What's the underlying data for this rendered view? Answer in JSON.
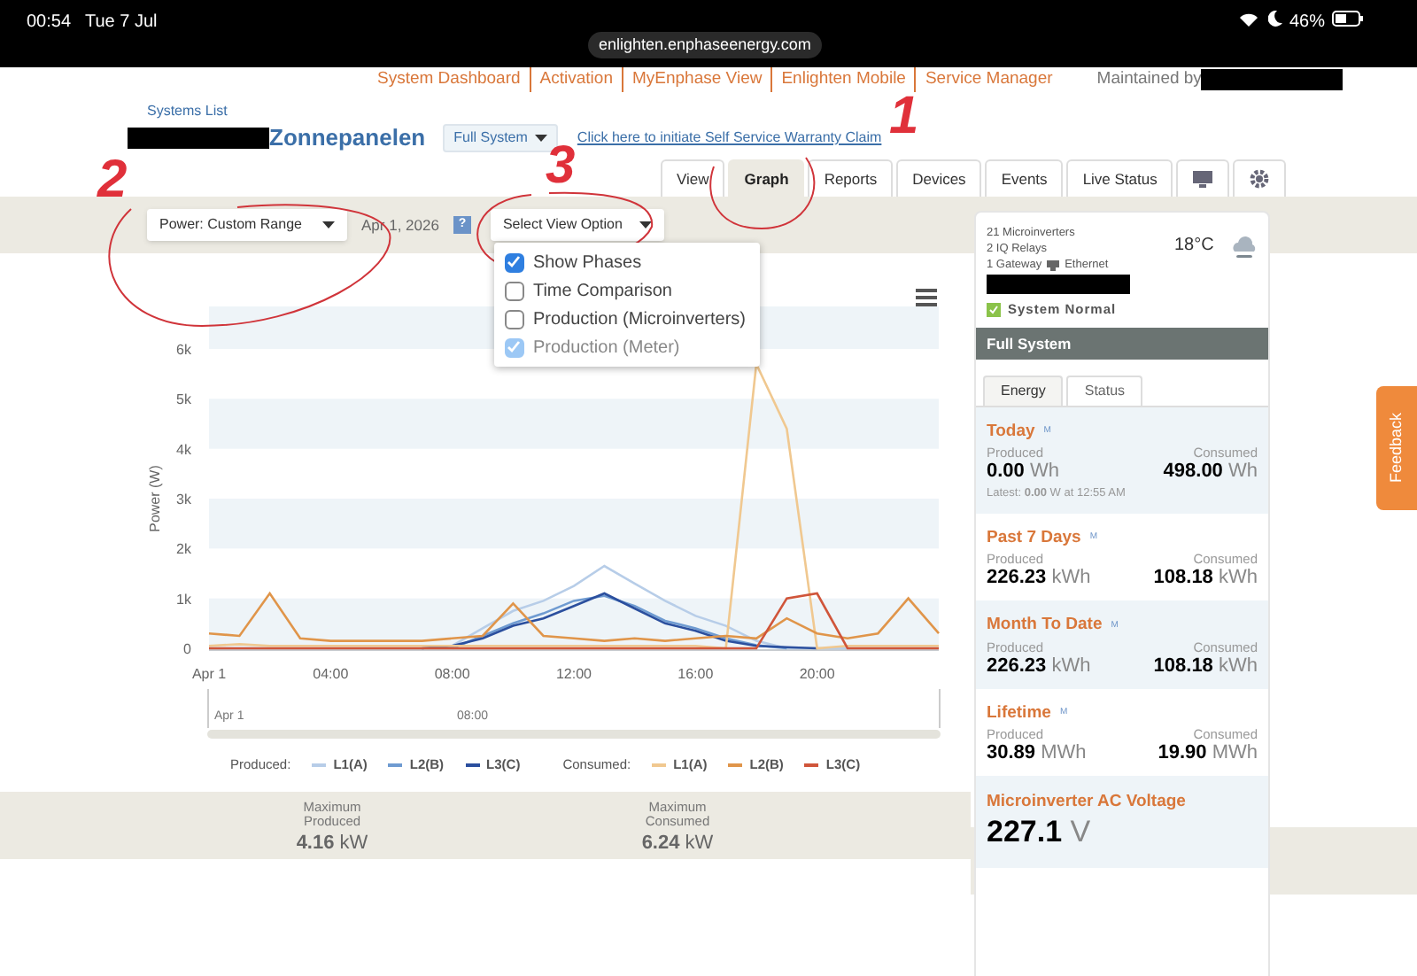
{
  "status_bar": {
    "time": "00:54",
    "date": "Tue 7 Jul",
    "battery": "46%"
  },
  "browser": {
    "url": "enlighten.enphaseenergy.com"
  },
  "top_links": [
    "System Dashboard",
    "Activation",
    "MyEnphase View",
    "Enlighten Mobile",
    "Service Manager"
  ],
  "maintained_by": "Maintained by",
  "systems_list": "Systems List",
  "system_name": "Zonnepanelen",
  "system_select": "Full System",
  "warranty_link": "Click here to initiate Self Service Warranty Claim",
  "tabs": [
    {
      "kind": "text",
      "label": "View",
      "selected": false
    },
    {
      "kind": "text",
      "label": "Graph",
      "selected": true
    },
    {
      "kind": "text",
      "label": "Reports",
      "selected": false
    },
    {
      "kind": "text",
      "label": "Devices",
      "selected": false
    },
    {
      "kind": "text",
      "label": "Events",
      "selected": false
    },
    {
      "kind": "text",
      "label": "Live Status",
      "selected": false
    },
    {
      "kind": "monitor",
      "selected": false
    },
    {
      "kind": "settings",
      "selected": false
    }
  ],
  "toolbar": {
    "range_select": "Power: Custom Range",
    "date": "Apr 1, 2026",
    "help": "?",
    "view_select": "Select View Option"
  },
  "view_options": [
    {
      "label": "Show Phases",
      "checked": true,
      "disabled": false
    },
    {
      "label": "Time Comparison",
      "checked": false,
      "disabled": false
    },
    {
      "label": "Production (Microinverters)",
      "checked": false,
      "disabled": false
    },
    {
      "label": "Production (Meter)",
      "checked": true,
      "disabled": true
    }
  ],
  "chart": {
    "chart_data": {
      "type": "line",
      "ylabel": "Power (W)",
      "x": [
        0,
        1,
        2,
        3,
        4,
        5,
        6,
        7,
        8,
        9,
        10,
        11,
        12,
        13,
        14,
        15,
        16,
        17,
        18,
        19,
        20,
        21,
        22,
        23,
        24
      ],
      "xticks": [
        {
          "value": 0,
          "label": "Apr 1"
        },
        {
          "value": 4,
          "label": "04:00"
        },
        {
          "value": 8,
          "label": "08:00"
        },
        {
          "value": 12,
          "label": "12:00"
        },
        {
          "value": 16,
          "label": "16:00"
        },
        {
          "value": 20,
          "label": "20:00"
        }
      ],
      "yticks": [
        {
          "value": 0,
          "label": "0"
        },
        {
          "value": 1000,
          "label": "1k"
        },
        {
          "value": 2000,
          "label": "2k"
        },
        {
          "value": 3000,
          "label": "3k"
        },
        {
          "value": 4000,
          "label": "4k"
        },
        {
          "value": 5000,
          "label": "5k"
        },
        {
          "value": 6000,
          "label": "6k"
        }
      ],
      "ylim": [
        0,
        6000
      ],
      "xlim": [
        0,
        24
      ],
      "series": [
        {
          "name": "L1(A)",
          "color": "#b7cde8",
          "values": [
            0,
            0,
            0,
            0,
            0,
            0,
            0,
            0,
            50,
            400,
            750,
            950,
            1250,
            1650,
            1300,
            950,
            650,
            450,
            150,
            0,
            0,
            0,
            0,
            0,
            0
          ]
        },
        {
          "name": "L2(B)",
          "color": "#6f9bd1",
          "values": [
            null,
            null,
            null,
            null,
            null,
            null,
            null,
            null,
            0,
            250,
            500,
            700,
            950,
            1050,
            850,
            550,
            400,
            200,
            60,
            0,
            null,
            null,
            null,
            null,
            null
          ]
        },
        {
          "name": "L3(C)",
          "color": "#2b4f9e",
          "values": [
            null,
            null,
            null,
            null,
            null,
            null,
            null,
            0,
            50,
            200,
            450,
            600,
            850,
            1100,
            800,
            500,
            350,
            150,
            50,
            20,
            0,
            null,
            null,
            null,
            null
          ]
        },
        {
          "name": "L1(A)",
          "color": "#f0c890",
          "values": [
            50,
            80,
            50,
            50,
            50,
            50,
            50,
            50,
            50,
            50,
            50,
            50,
            50,
            50,
            50,
            50,
            50,
            0,
            5700,
            4400,
            0,
            50,
            50,
            50,
            50
          ]
        },
        {
          "name": "L2(B)",
          "color": "#e0954a",
          "values": [
            300,
            250,
            1100,
            200,
            150,
            150,
            150,
            150,
            200,
            250,
            900,
            250,
            200,
            150,
            200,
            150,
            200,
            250,
            200,
            600,
            300,
            200,
            300,
            1000,
            300
          ]
        },
        {
          "name": "L3(C)",
          "color": "#d0553a",
          "values": [
            0,
            0,
            0,
            0,
            0,
            0,
            0,
            0,
            0,
            0,
            0,
            0,
            0,
            0,
            0,
            0,
            0,
            0,
            0,
            1000,
            1100,
            0,
            0,
            0,
            0
          ]
        }
      ]
    },
    "legend": {
      "produced": "Produced:",
      "consumed": "Consumed:"
    },
    "navigator": [
      "Apr 1",
      "08:00"
    ]
  },
  "maximums": [
    {
      "label": "Maximum Produced",
      "value": "4.16",
      "unit": "kW"
    },
    {
      "label": "Maximum Consumed",
      "value": "6.24",
      "unit": "kW"
    }
  ],
  "panel": {
    "devices": [
      "21 Microinverters",
      "2 IQ Relays",
      "1 Gateway"
    ],
    "connection": "Ethernet",
    "temperature": "18°C",
    "status": "System Normal",
    "header": "Full System",
    "tabs": [
      {
        "label": "Energy",
        "selected": true
      },
      {
        "label": "Status",
        "selected": false
      }
    ],
    "sections": [
      {
        "kind": "energy",
        "title": "Today",
        "badge": "M",
        "produced_label": "Produced",
        "produced_value": "0.00",
        "produced_unit": "Wh",
        "consumed_label": "Consumed",
        "consumed_value": "498.00",
        "consumed_unit": "Wh",
        "latest": "Latest: **0.00** W at 12:55 AM"
      },
      {
        "kind": "energy",
        "title": "Past 7 Days",
        "badge": "M",
        "produced_label": "Produced",
        "produced_value": "226.23",
        "produced_unit": "kWh",
        "consumed_label": "Consumed",
        "consumed_value": "108.18",
        "consumed_unit": "kWh"
      },
      {
        "kind": "energy",
        "title": "Month To Date",
        "badge": "M",
        "produced_label": "Produced",
        "produced_value": "226.23",
        "produced_unit": "kWh",
        "consumed_label": "Consumed",
        "consumed_value": "108.18",
        "consumed_unit": "kWh"
      },
      {
        "kind": "energy",
        "title": "Lifetime",
        "badge": "M",
        "produced_label": "Produced",
        "produced_value": "30.89",
        "produced_unit": "MWh",
        "consumed_label": "Consumed",
        "consumed_value": "19.90",
        "consumed_unit": "MWh"
      },
      {
        "kind": "voltage",
        "title": "Microinverter AC Voltage",
        "value": "227.1",
        "unit": "V"
      }
    ]
  },
  "feedback": "Feedback",
  "annotations": [
    {
      "label": "1"
    },
    {
      "label": "2"
    },
    {
      "label": "3"
    }
  ]
}
